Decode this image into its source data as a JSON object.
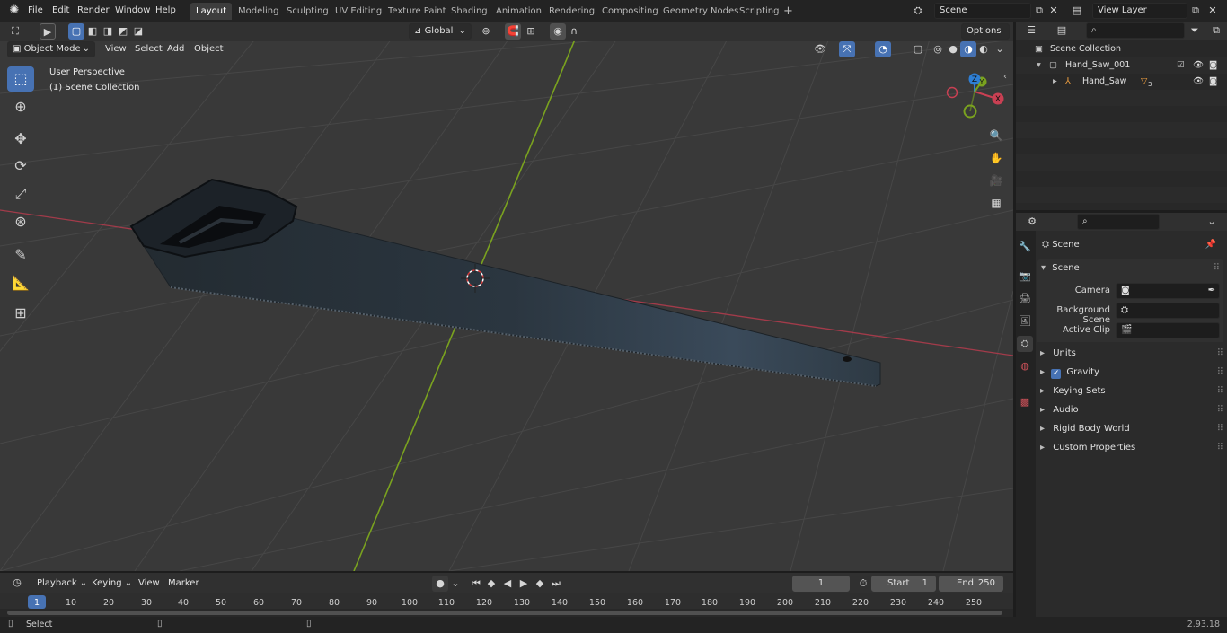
{
  "topbar": {
    "menus": [
      "File",
      "Edit",
      "Render",
      "Window",
      "Help"
    ],
    "workspaces": [
      "Layout",
      "Modeling",
      "Sculpting",
      "UV Editing",
      "Texture Paint",
      "Shading",
      "Animation",
      "Rendering",
      "Compositing",
      "Geometry Nodes",
      "Scripting"
    ],
    "active_workspace": "Layout",
    "add_tab": "+",
    "scene_name": "Scene",
    "view_layer": "View Layer"
  },
  "viewport": {
    "mode": "Object Mode",
    "menus": [
      "View",
      "Select",
      "Add",
      "Object"
    ],
    "transform_orientation": "Global",
    "options_label": "Options",
    "info_line1": "User Perspective",
    "info_line2": "(1) Scene Collection",
    "gizmo_axes": {
      "x": "X",
      "y": "Y",
      "z": "Z"
    }
  },
  "outliner": {
    "root": "Scene Collection",
    "items": [
      {
        "name": "Hand_Saw_001"
      },
      {
        "name": "Hand_Saw",
        "modifier_count": "3"
      }
    ]
  },
  "properties": {
    "context": "Scene",
    "panel_title": "Scene",
    "fields": [
      {
        "label": "Camera",
        "value": ""
      },
      {
        "label": "Background Scene",
        "value": ""
      },
      {
        "label": "Active Clip",
        "value": ""
      }
    ],
    "subpanels": [
      "Units",
      "Gravity",
      "Keying Sets",
      "Audio",
      "Rigid Body World",
      "Custom Properties"
    ]
  },
  "timeline": {
    "menus": [
      "Playback",
      "Keying",
      "View",
      "Marker"
    ],
    "current_frame": "1",
    "start_label": "Start",
    "start_value": "1",
    "end_label": "End",
    "end_value": "250",
    "ruler": [
      "1",
      "10",
      "20",
      "30",
      "40",
      "50",
      "60",
      "70",
      "80",
      "90",
      "100",
      "110",
      "120",
      "130",
      "140",
      "150",
      "160",
      "170",
      "180",
      "190",
      "200",
      "210",
      "220",
      "230",
      "240",
      "250"
    ]
  },
  "statusbar": {
    "left": "Select",
    "version": "2.93.18"
  },
  "colors": {
    "accent": "#4772b3",
    "x_axis": "#c94053",
    "y_axis": "#7aa21f",
    "z_axis": "#2e7fd6"
  }
}
